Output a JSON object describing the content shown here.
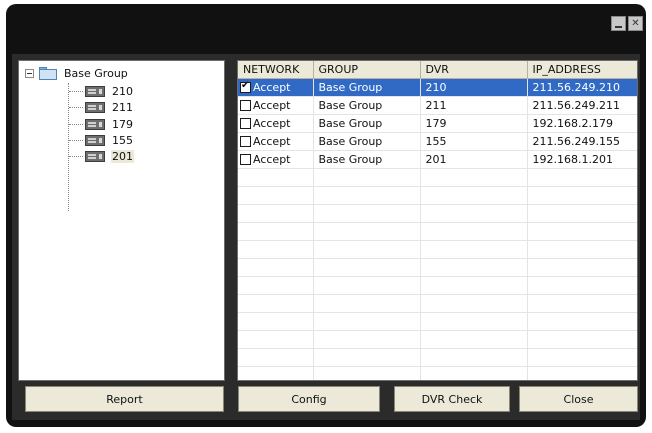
{
  "tree": {
    "root_label": "Base Group",
    "items": [
      {
        "label": "210"
      },
      {
        "label": "211"
      },
      {
        "label": "179"
      },
      {
        "label": "155"
      },
      {
        "label": "201"
      }
    ],
    "selected_item": "201"
  },
  "grid": {
    "columns": [
      "NETWORK",
      "GROUP",
      "DVR",
      "IP_ADDRESS"
    ],
    "rows": [
      {
        "checked": true,
        "network": "Accept",
        "group": "Base Group",
        "dvr": "210",
        "ip": "211.56.249.210",
        "selected": true
      },
      {
        "checked": false,
        "network": "Accept",
        "group": "Base Group",
        "dvr": "211",
        "ip": "211.56.249.211",
        "selected": false
      },
      {
        "checked": false,
        "network": "Accept",
        "group": "Base Group",
        "dvr": "179",
        "ip": "192.168.2.179",
        "selected": false
      },
      {
        "checked": false,
        "network": "Accept",
        "group": "Base Group",
        "dvr": "155",
        "ip": "211.56.249.155",
        "selected": false
      },
      {
        "checked": false,
        "network": "Accept",
        "group": "Base Group",
        "dvr": "201",
        "ip": "192.168.1.201",
        "selected": false
      }
    ]
  },
  "buttons": {
    "report": "Report",
    "config": "Config",
    "dvr_check": "DVR Check",
    "close": "Close"
  },
  "titlebar": {
    "minimize_icon": "minimize-icon",
    "close_icon": "close-icon",
    "close_glyph": "✕"
  },
  "colors": {
    "window_bg": "#111111",
    "selection": "#316ac5",
    "header_bg": "#ece9d8"
  }
}
